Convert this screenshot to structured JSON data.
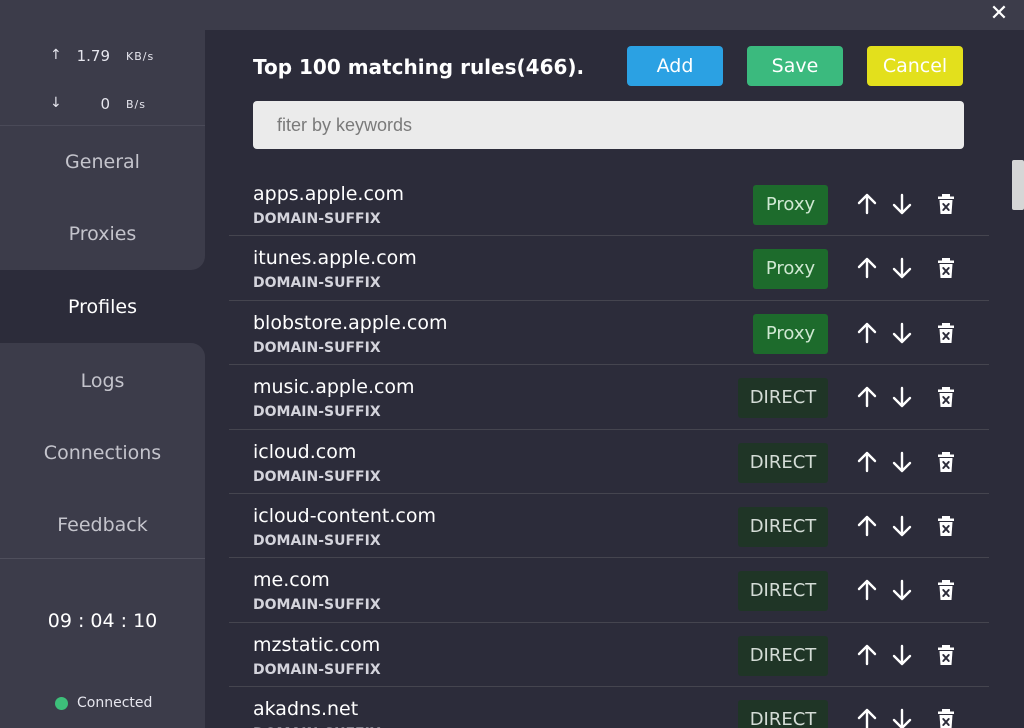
{
  "window": {
    "close_glyph": "✕"
  },
  "speed": {
    "up": {
      "arrow": "↑",
      "value": "1.79",
      "unit": "KB/s"
    },
    "down": {
      "arrow": "↓",
      "value": "0",
      "unit": "B/s"
    }
  },
  "nav": {
    "items": [
      {
        "label": "General"
      },
      {
        "label": "Proxies"
      },
      {
        "label": "Profiles"
      },
      {
        "label": "Logs"
      },
      {
        "label": "Connections"
      },
      {
        "label": "Feedback"
      }
    ],
    "active": "Profiles"
  },
  "clock": "09 : 04 : 10",
  "status": {
    "label": "Connected",
    "color": "#3dbf7a"
  },
  "main": {
    "title": "Top 100 matching rules(466).",
    "buttons": {
      "add": "Add",
      "save": "Save",
      "cancel": "Cancel"
    },
    "filter_placeholder": "fiter by keywords"
  },
  "rules": [
    {
      "domain": "apps.apple.com",
      "type": "DOMAIN-SUFFIX",
      "policy": "Proxy"
    },
    {
      "domain": "itunes.apple.com",
      "type": "DOMAIN-SUFFIX",
      "policy": "Proxy"
    },
    {
      "domain": "blobstore.apple.com",
      "type": "DOMAIN-SUFFIX",
      "policy": "Proxy"
    },
    {
      "domain": "music.apple.com",
      "type": "DOMAIN-SUFFIX",
      "policy": "DIRECT"
    },
    {
      "domain": "icloud.com",
      "type": "DOMAIN-SUFFIX",
      "policy": "DIRECT"
    },
    {
      "domain": "icloud-content.com",
      "type": "DOMAIN-SUFFIX",
      "policy": "DIRECT"
    },
    {
      "domain": "me.com",
      "type": "DOMAIN-SUFFIX",
      "policy": "DIRECT"
    },
    {
      "domain": "mzstatic.com",
      "type": "DOMAIN-SUFFIX",
      "policy": "DIRECT"
    },
    {
      "domain": "akadns.net",
      "type": "DOMAIN-SUFFIX",
      "policy": "DIRECT"
    }
  ],
  "colors": {
    "accent_add": "#2ba1e3",
    "accent_save": "#3bba7e",
    "accent_cancel": "#e3e01c",
    "proxy_badge": "#1d6b2c",
    "direct_badge": "#1f3526"
  }
}
